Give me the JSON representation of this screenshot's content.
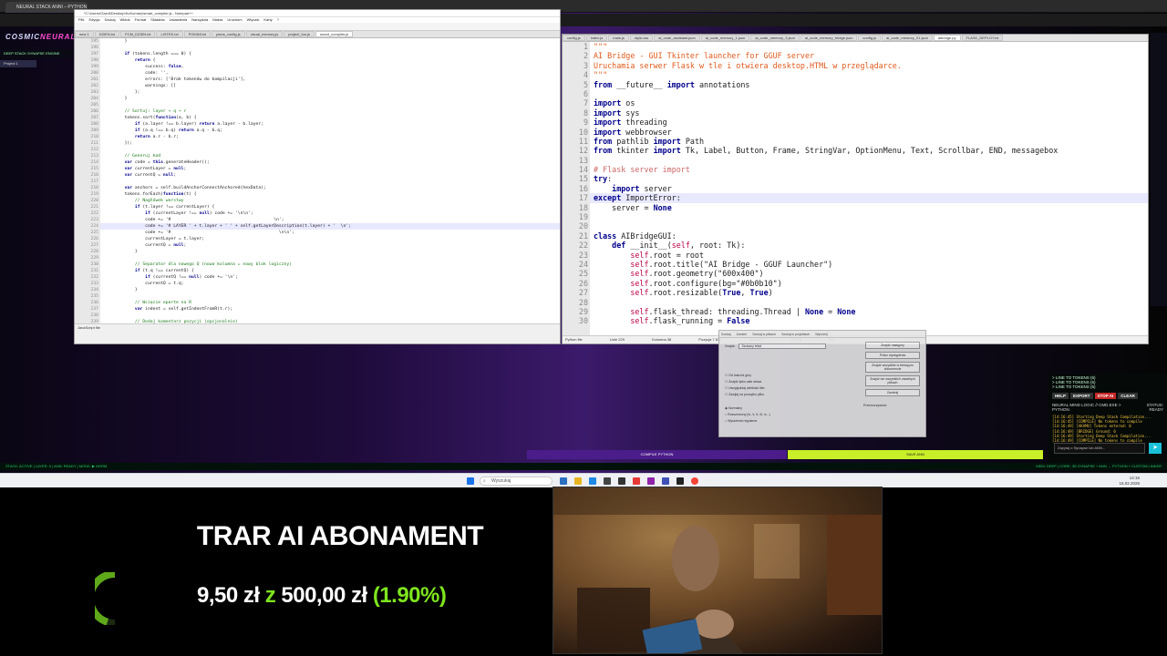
{
  "browser": {
    "tab_title": "NEURAL STACK ANNI – PYTHON B..."
  },
  "app": {
    "brand_a": "COSMIC",
    "brand_b": "NEURAL ST",
    "subtitle": "DEEP STACK SYNAPSE ENGINE",
    "project_tab": "Project 1"
  },
  "npp_left": {
    "title": "*C:\\Users\\Gazdi\\Desktop\\KuKomary\\smart_compiler.js - Notepad++",
    "menu": [
      "Plik",
      "Edycja",
      "Szukaj",
      "Widok",
      "Format",
      "Składnia",
      "Ustawienia",
      "Narzędzia",
      "Makra",
      "Uruchom",
      "Wtyczki",
      "Karty",
      "?"
    ],
    "tabs": [
      "new 1",
      "DZIEN.txt",
      "PCM_DZIEN.txt",
      "LISTEK.txt",
      "POMINI.txt",
      "plans_config.js",
      "visual_memory.js",
      "project_fun.js",
      "smart_compiler.js"
    ],
    "lines": [
      {
        "n": "195",
        "t": "        }"
      },
      {
        "n": "196",
        "t": ""
      },
      {
        "n": "197",
        "t": "        if (tokens.length === 0) {"
      },
      {
        "n": "198",
        "t": "            return {"
      },
      {
        "n": "199",
        "t": "                success: false,"
      },
      {
        "n": "200",
        "t": "                code: '',"
      },
      {
        "n": "201",
        "t": "                errors: ['Brak tokenów do kompilacji'],"
      },
      {
        "n": "202",
        "t": "                warnings: []"
      },
      {
        "n": "203",
        "t": "            };"
      },
      {
        "n": "204",
        "t": "        }"
      },
      {
        "n": "205",
        "t": ""
      },
      {
        "n": "206",
        "t": "        // Sortuj: layer → q → r"
      },
      {
        "n": "207",
        "t": "        tokens.sort(function(a, b) {"
      },
      {
        "n": "208",
        "t": "            if (a.layer !== b.layer) return a.layer - b.layer;"
      },
      {
        "n": "209",
        "t": "            if (a.q !== b.q) return a.q - b.q;"
      },
      {
        "n": "210",
        "t": "            return a.r - b.r;"
      },
      {
        "n": "211",
        "t": "        });"
      },
      {
        "n": "212",
        "t": ""
      },
      {
        "n": "213",
        "t": "        // Generuj kod"
      },
      {
        "n": "214",
        "t": "        var code = this.generateHeader();"
      },
      {
        "n": "215",
        "t": "        var currentLayer = null;"
      },
      {
        "n": "216",
        "t": "        var currentQ = null;"
      },
      {
        "n": "217",
        "t": ""
      },
      {
        "n": "218",
        "t": "        var anchors = self.buildAnchorConnectAnchored(hexData);"
      },
      {
        "n": "219",
        "t": "        tokens.forEach(function(t) {"
      },
      {
        "n": "220",
        "t": "            // Nagłówek warstwy"
      },
      {
        "n": "221",
        "t": "            if (t.layer !== currentLayer) {"
      },
      {
        "n": "222",
        "t": "                if (currentLayer !== null) code += '\\n\\n';"
      },
      {
        "n": "223",
        "t": "                code += '#                                        \\n';"
      },
      {
        "n": "224",
        "t": "                code += '# LAYER ' + t.layer + ' ' + self.getLayerDescription(t.layer) + '  \\n';"
      },
      {
        "n": "225",
        "t": "                code += '#                                          \\n\\n';"
      },
      {
        "n": "226",
        "t": "                currentLayer = t.layer;"
      },
      {
        "n": "227",
        "t": "                currentQ = null;"
      },
      {
        "n": "228",
        "t": "            }"
      },
      {
        "n": "229",
        "t": ""
      },
      {
        "n": "230",
        "t": "            // Separator dla nowego Q (nowa kolumna = nowy blok logiczny)"
      },
      {
        "n": "231",
        "t": "            if (t.q !== currentQ) {"
      },
      {
        "n": "232",
        "t": "                if (currentQ !== null) code += '\\n';"
      },
      {
        "n": "233",
        "t": "                currentQ = t.q;"
      },
      {
        "n": "234",
        "t": "            }"
      },
      {
        "n": "235",
        "t": ""
      },
      {
        "n": "236",
        "t": "            // Wcięcie oparte na R"
      },
      {
        "n": "237",
        "t": "            var indent = self.getIndentFromR(t.r);"
      },
      {
        "n": "238",
        "t": ""
      },
      {
        "n": "239",
        "t": "            // Dodaj komentarz pozycji (opcjonalnie)"
      }
    ],
    "status": "JavaScript file"
  },
  "npp_right": {
    "tabs": [
      "config.js",
      "index.js",
      "main.js",
      "style.css",
      "ai_code_assistant.json",
      "ai_code_memory_1.json",
      "ai_code_memory_3.json",
      "ai_code_memory_bridge.json",
      "config.js",
      "ai_code_memory_01.json",
      "aibridge.py",
      "FLASK_DEPLOY.txt"
    ],
    "lines": [
      {
        "n": "1",
        "t": "\"\"\""
      },
      {
        "n": "2",
        "t": "AI Bridge - GUI Tkinter launcher for GGUF server"
      },
      {
        "n": "3",
        "t": "Uruchamia serwer Flask w tle i otwiera desktop.HTML w przeglądarce."
      },
      {
        "n": "4",
        "t": "\"\"\""
      },
      {
        "n": "5",
        "t": "from __future__ import annotations"
      },
      {
        "n": "6",
        "t": ""
      },
      {
        "n": "7",
        "t": "import os"
      },
      {
        "n": "8",
        "t": "import sys"
      },
      {
        "n": "9",
        "t": "import threading"
      },
      {
        "n": "10",
        "t": "import webbrowser"
      },
      {
        "n": "11",
        "t": "from pathlib import Path"
      },
      {
        "n": "12",
        "t": "from tkinter import Tk, Label, Button, Frame, StringVar, OptionMenu, Text, Scrollbar, END, messagebox"
      },
      {
        "n": "13",
        "t": ""
      },
      {
        "n": "14",
        "t": "# Flask server import"
      },
      {
        "n": "15",
        "t": "try:"
      },
      {
        "n": "16",
        "t": "    import server"
      },
      {
        "n": "17",
        "t": "except ImportError:"
      },
      {
        "n": "18",
        "t": "    server = None"
      },
      {
        "n": "19",
        "t": ""
      },
      {
        "n": "20",
        "t": ""
      },
      {
        "n": "21",
        "t": "class AIBridgeGUI:"
      },
      {
        "n": "22",
        "t": "    def __init__(self, root: Tk):"
      },
      {
        "n": "23",
        "t": "        self.root = root"
      },
      {
        "n": "24",
        "t": "        self.root.title(\"AI Bridge - GGUF Launcher\")"
      },
      {
        "n": "25",
        "t": "        self.root.geometry(\"600x400\")"
      },
      {
        "n": "26",
        "t": "        self.root.configure(bg=\"#0b0b10\")"
      },
      {
        "n": "27",
        "t": "        self.root.resizable(True, True)"
      },
      {
        "n": "28",
        "t": ""
      },
      {
        "n": "29",
        "t": "        self.flask_thread: threading.Thread | None = None"
      },
      {
        "n": "30",
        "t": "        self.flask_running = False"
      }
    ],
    "status_parts": [
      "Python file",
      "Linie 229",
      "Kolumna 38",
      "Pozycja 7 638",
      "Unix (LF)",
      "UTF-8",
      "INS"
    ]
  },
  "dialog": {
    "tabs": [
      "Szukaj",
      "Zamień",
      "Szukaj w plikach",
      "Szukaj w projektach",
      "Wyróżnij"
    ],
    "find_label": "Znajdź:",
    "find_value": "Szukany tekst",
    "buttons": [
      "Znajdź następny",
      "Policz wystąpienia",
      "Znajdź wszystkie w bieżącym dokumencie",
      "Znajdź we wszystkich otwartych plikach",
      "Zamknij"
    ],
    "options": [
      "Od dołu/od góry",
      "Znajdź tylko całe słowa",
      "Uwzględniaj wielkość liter",
      "Zawijaj na początku pliku"
    ],
    "modes": [
      "Normalny",
      "Rozszerzony (\\n, \\r, \\t, \\0, \\x...)",
      "Wyrażenia regularne"
    ],
    "transparency": "Przezroczystość"
  },
  "right_panel": {
    "token_lines": [
      "> LINE TO TOKENS (5)",
      "> LINE TO TOKENS (5)",
      "> LINE TO TOKENS (5)"
    ],
    "buttons": [
      "HELP",
      "EXPORT",
      "STOP AI",
      "CLEAR"
    ],
    "status_a": "NEURAL MIND LOGIC // CMD.EXE >",
    "lang": "PYTHON",
    "status_label": "STATUS:",
    "status_value": "READY",
    "log": [
      "[14:16:45] Starting Deep Stack Compilation...",
      "[14:16:45] [COMPILE] No tokens to compile",
      "[14:16:49] [AKAMU] Tokens entered: 0",
      "[14:16:49] [BRIDGE] Ground: 0",
      "[14:16:49] Starting Deep Stack Compilation...",
      "[14:16:49] [COMPILE] No tokens to compile"
    ],
    "input_placeholder": "Zapytaj o Synapse lub ANN..."
  },
  "bottom_bars": {
    "compile": "COMPILE PYTHON",
    "save": "SAVE ANN"
  },
  "status_strip": {
    "left": "STACK: ACTIVE | LAYER: 0 | ANN: READY | MODE: ▶ NORM",
    "right": "MEM: DEEP | CORE: 3D SYNAPSE + ANN → PYTHON + CUSTOM LINKER"
  },
  "taskbar": {
    "search": "Wyszukaj",
    "time": "14:16",
    "date": "16.02.2026"
  },
  "overlay": {
    "title": "TRAR AI ABONAMENT",
    "current": "9,50 zł",
    "connector": "z",
    "goal": "500,00 zł",
    "percent": "(1.90%)",
    "progress_fraction": 0.019
  }
}
